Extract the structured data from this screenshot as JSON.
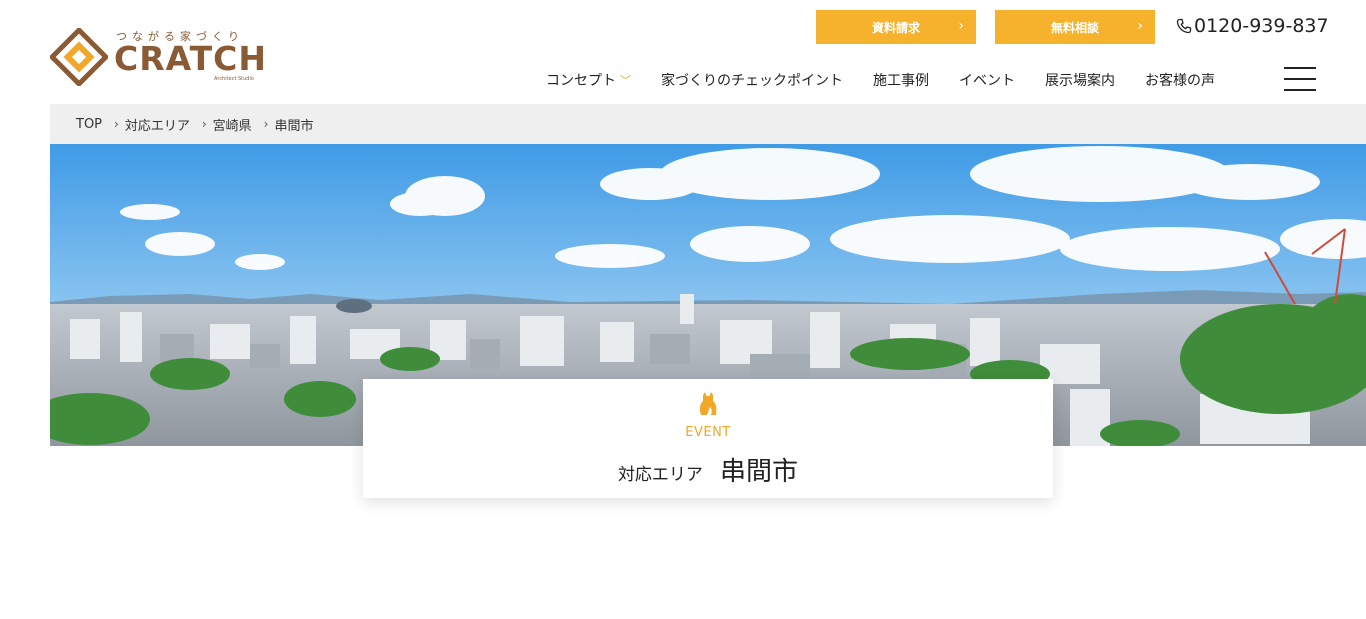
{
  "brand": {
    "tagline": "つながる家づくり",
    "name": "CRATCH",
    "sub": "Architect Studio",
    "color": "#8a5a34"
  },
  "header": {
    "cta_docs": "資料請求",
    "cta_consult": "無料相談",
    "phone": "0120-939-837",
    "accent_color": "#f6b12d"
  },
  "nav": {
    "items": [
      {
        "label": "コンセプト",
        "has_dropdown": true
      },
      {
        "label": "家づくりのチェックポイント"
      },
      {
        "label": "施工事例"
      },
      {
        "label": "イベント"
      },
      {
        "label": "展示場案内"
      },
      {
        "label": "お客様の声"
      }
    ],
    "menu_icon": "hamburger-icon"
  },
  "breadcrumb": {
    "items": [
      "TOP",
      "対応エリア",
      "宮崎県",
      "串間市"
    ],
    "separator": ">"
  },
  "hero": {
    "image": "city-panorama-sky"
  },
  "title_card": {
    "icon": "cat-icon",
    "section": "EVENT",
    "prefix": "対応エリア",
    "title": "串間市"
  }
}
